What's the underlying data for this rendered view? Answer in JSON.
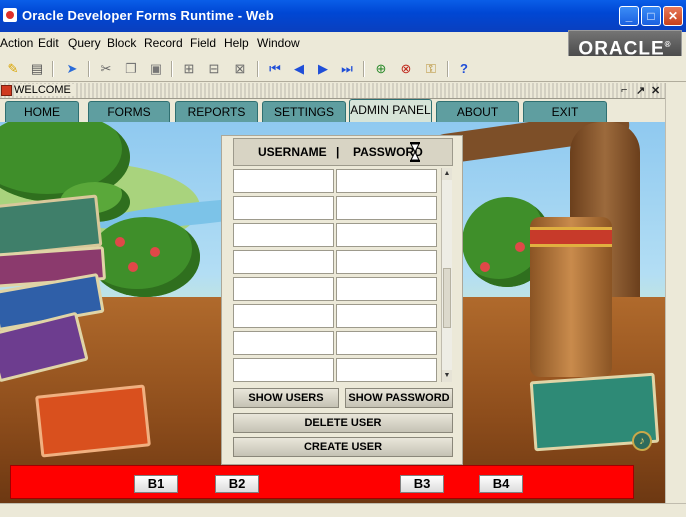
{
  "window": {
    "title": "Oracle Developer Forms Runtime - Web",
    "controls": {
      "minimize": "_",
      "maximize": "□",
      "close": "✕"
    }
  },
  "menu": {
    "items": [
      "Action",
      "Edit",
      "Query",
      "Block",
      "Record",
      "Field",
      "Help",
      "Window"
    ],
    "logo": "ORACLE"
  },
  "toolbar": {
    "icons": [
      "save-icon",
      "print-icon",
      "exit-icon",
      "cut-icon",
      "copy-icon",
      "paste-icon",
      "enter-query-icon",
      "execute-query-icon",
      "cancel-query-icon",
      "first-record-icon",
      "previous-record-icon",
      "next-record-icon",
      "last-record-icon",
      "insert-record-icon",
      "delete-record-icon",
      "lock-record-icon",
      "help-icon"
    ]
  },
  "inner_window": {
    "title": "WELCOME",
    "controls": [
      "⌐",
      "↗",
      "✕"
    ]
  },
  "tabs": [
    {
      "label": "HOME",
      "active": false
    },
    {
      "label": "FORMS",
      "active": false
    },
    {
      "label": "REPORTS",
      "active": false
    },
    {
      "label": "SETTINGS",
      "active": false
    },
    {
      "label": "ADMIN PANEL",
      "active": true
    },
    {
      "label": "ABOUT",
      "active": false
    },
    {
      "label": "EXIT",
      "active": false
    }
  ],
  "admin_panel": {
    "col_username": "USERNAME",
    "separator": "|",
    "col_password": "PASSWORD",
    "rows": 8,
    "buttons": {
      "show_users": "SHOW USERS",
      "show_password": "SHOW PASSWORD",
      "delete_user": "DELETE USER",
      "create_user": "CREATE USER"
    }
  },
  "bottom_bar": {
    "color": "#ff0000",
    "buttons": [
      "B1",
      "B2",
      "B3",
      "B4"
    ]
  },
  "colors": {
    "titlebar": "#0a5ee8",
    "tab": "#5f9ea0",
    "active_tab": "#d6e4d8",
    "red_bar": "#ff0000"
  }
}
